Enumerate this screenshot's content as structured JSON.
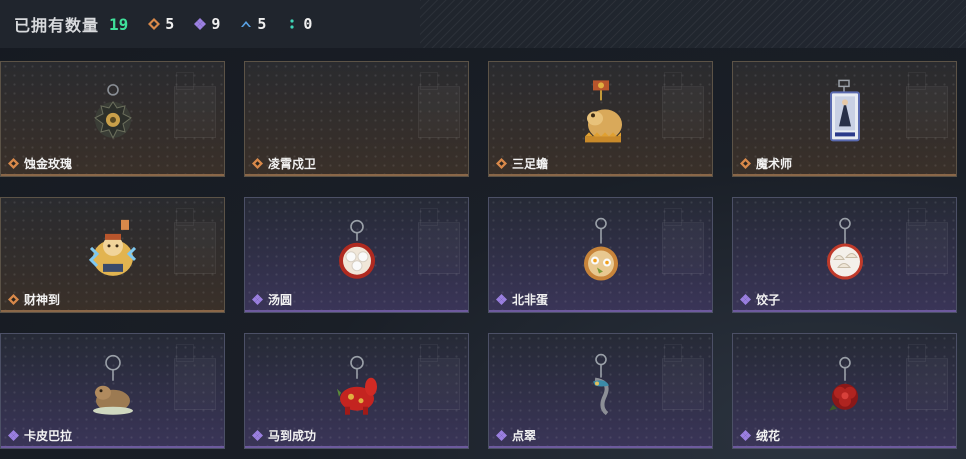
{
  "header": {
    "owned_label": "已拥有数量",
    "owned_count": "19",
    "stats": [
      {
        "icon": "orange-diamond-icon",
        "value": "5",
        "color": "#d9894a"
      },
      {
        "icon": "purple-diamond-icon",
        "value": "9",
        "color": "#9a7fe0"
      },
      {
        "icon": "blue-chevron-icon",
        "value": "5",
        "color": "#5aa3e6"
      },
      {
        "icon": "teal-dots-icon",
        "value": "0",
        "color": "#3fd6b8"
      }
    ]
  },
  "colors": {
    "owned_count": "#3fe09a",
    "orange_rarity": "#d9894a",
    "purple_rarity": "#9a7fe0"
  },
  "items": [
    {
      "name": "蚀金玫瑰",
      "rarity": "orange",
      "icon": "gear-rose-charm-icon"
    },
    {
      "name": "凌霄戍卫",
      "rarity": "orange",
      "icon": ""
    },
    {
      "name": "三足蟾",
      "rarity": "orange",
      "icon": "three-legged-toad-charm-icon"
    },
    {
      "name": "魔术师",
      "rarity": "orange",
      "icon": "magician-card-charm-icon"
    },
    {
      "name": "财神到",
      "rarity": "orange",
      "icon": "fortune-god-charm-icon"
    },
    {
      "name": "汤圆",
      "rarity": "purple",
      "icon": "tangyuan-bowl-charm-icon"
    },
    {
      "name": "北非蛋",
      "rarity": "purple",
      "icon": "shakshuka-pan-charm-icon"
    },
    {
      "name": "饺子",
      "rarity": "purple",
      "icon": "dumpling-plate-charm-icon"
    },
    {
      "name": "卡皮巴拉",
      "rarity": "purple",
      "icon": "capybara-charm-icon"
    },
    {
      "name": "马到成功",
      "rarity": "purple",
      "icon": "red-horse-charm-icon"
    },
    {
      "name": "点翠",
      "rarity": "purple",
      "icon": "kingfisher-hairpin-charm-icon"
    },
    {
      "name": "绒花",
      "rarity": "purple",
      "icon": "velvet-flower-charm-icon"
    }
  ]
}
